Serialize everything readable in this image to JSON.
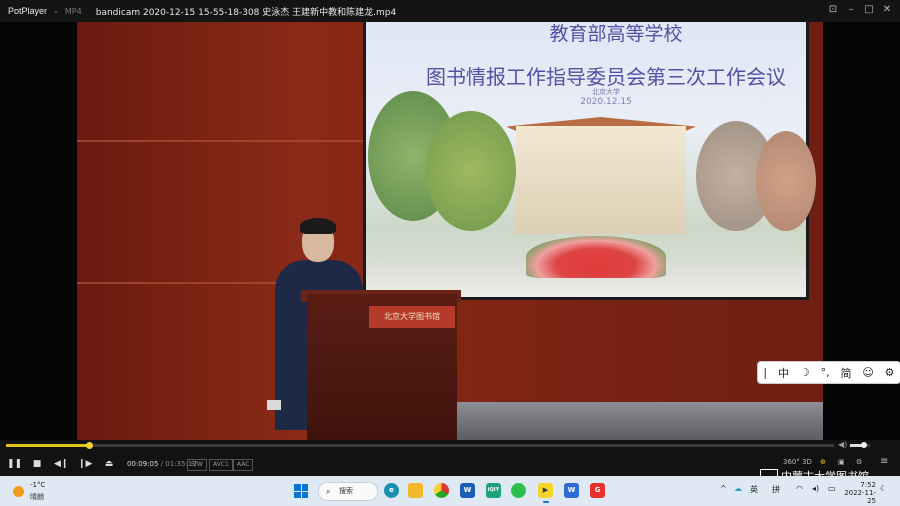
{
  "titlebar": {
    "app_name": "PotPlayer",
    "format": "MP4",
    "filename": "bandicam 2020-12-15 15-55-18-308 史泳杰 王建新中教和陈建龙.mp4"
  },
  "slide": {
    "title_line1": "教育部高等学校",
    "title_line2": "图书情报工作指导委员会第三次工作会议",
    "subtitle": "北京大学",
    "date": "2020.12.15"
  },
  "podium": {
    "plaque": "北京大学图书馆"
  },
  "ime": {
    "cursor": "|",
    "mode": "中",
    "moon": "☽",
    "punct": "°,",
    "simplified": "简",
    "emoji": "☺",
    "settings": "⚙"
  },
  "player": {
    "progress": 0.1,
    "volume": 0.7,
    "time_current": "00:09:05",
    "time_total": "/ 01:35:17",
    "tags": [
      "S/W",
      "AVC1",
      "AAC"
    ],
    "right_labels": [
      "360°",
      "3D"
    ]
  },
  "taskbar": {
    "temperature": "-1°C",
    "weather": "晴朗",
    "search_label": "搜索",
    "tray_lang": "英",
    "tray_ime": "拼",
    "time": "7:52",
    "date": "2022-11-25"
  },
  "watermark": "内蒙古大学图书馆"
}
